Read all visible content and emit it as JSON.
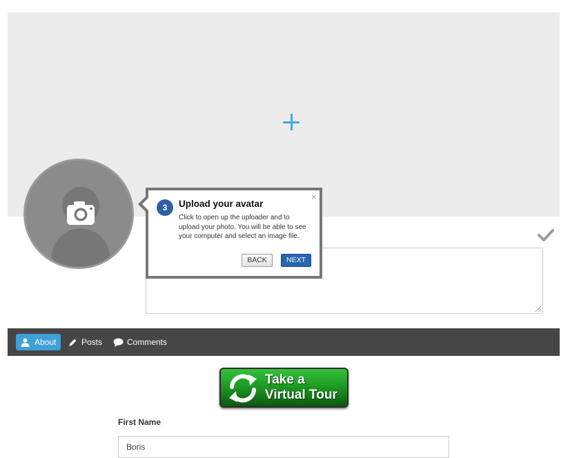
{
  "cover": {
    "add_icon": "plus-icon"
  },
  "avatar": {
    "icon": "camera-icon"
  },
  "actions": {
    "confirm_icon": "checkmark-icon"
  },
  "tour_step": {
    "step_number": "3",
    "title": "Upload your avatar",
    "body": "Click to open up the uploader and to upload your photo. You will be able to see your computer and select an image file.",
    "close_symbol": "×",
    "back_label": "BACK",
    "next_label": "NEXT"
  },
  "tabs": [
    {
      "label": "About",
      "icon": "user-icon",
      "active": true
    },
    {
      "label": "Posts",
      "icon": "pencil-icon",
      "active": false
    },
    {
      "label": "Comments",
      "icon": "speech-bubble-icon",
      "active": false
    }
  ],
  "tour_banner": {
    "line1": "Take a",
    "line2": "Virtual Tour",
    "icon": "refresh-arrows-icon"
  },
  "form": {
    "first_name_label": "First Name",
    "first_name_value": "Boris"
  },
  "colors": {
    "accent": "#3fa9dd",
    "tab_active": "#3fa0d8",
    "tabbar_bg": "#464646",
    "next_button": "#2866b0",
    "step_badge": "#2f5fa8"
  }
}
